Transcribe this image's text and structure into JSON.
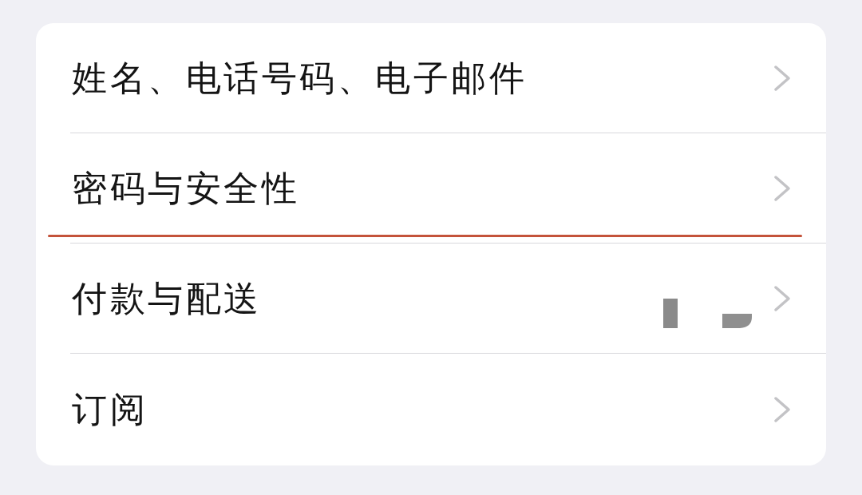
{
  "rows": [
    {
      "label": "姓名、电话号码、电子邮件",
      "underlined": false,
      "value_redacted": false
    },
    {
      "label": "密码与安全性",
      "underlined": true,
      "value_redacted": false
    },
    {
      "label": "付款与配送",
      "underlined": false,
      "value_redacted": true
    },
    {
      "label": "订阅",
      "underlined": false,
      "value_redacted": false
    }
  ]
}
